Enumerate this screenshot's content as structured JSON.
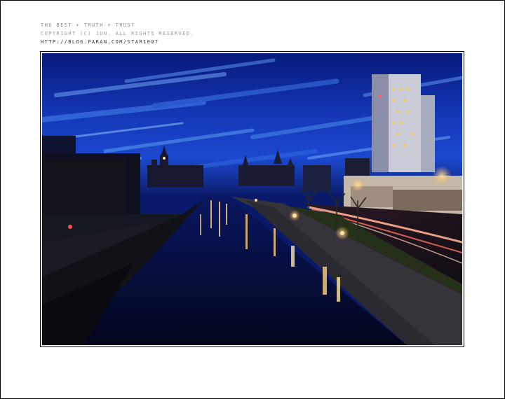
{
  "credits": {
    "line1": "THE BEST + TRUTH + TRUST",
    "line2": "COPYRIGHT (C) JUN. ALL RIGHTS RESERVED.",
    "line3": "HTTP://BLOG.PARAN.COM/STAR1007"
  },
  "photo": {
    "subject": "night-canal-cityscape",
    "colors": {
      "sky_top": "#0a1d8c",
      "sky_mid": "#1c44c8",
      "sky_glow": "#4a8ef0",
      "water": "#050a2a",
      "city_dark": "#0c0f1e",
      "lights": "#ffd27a",
      "light_trails": "#ff8a6a"
    }
  }
}
